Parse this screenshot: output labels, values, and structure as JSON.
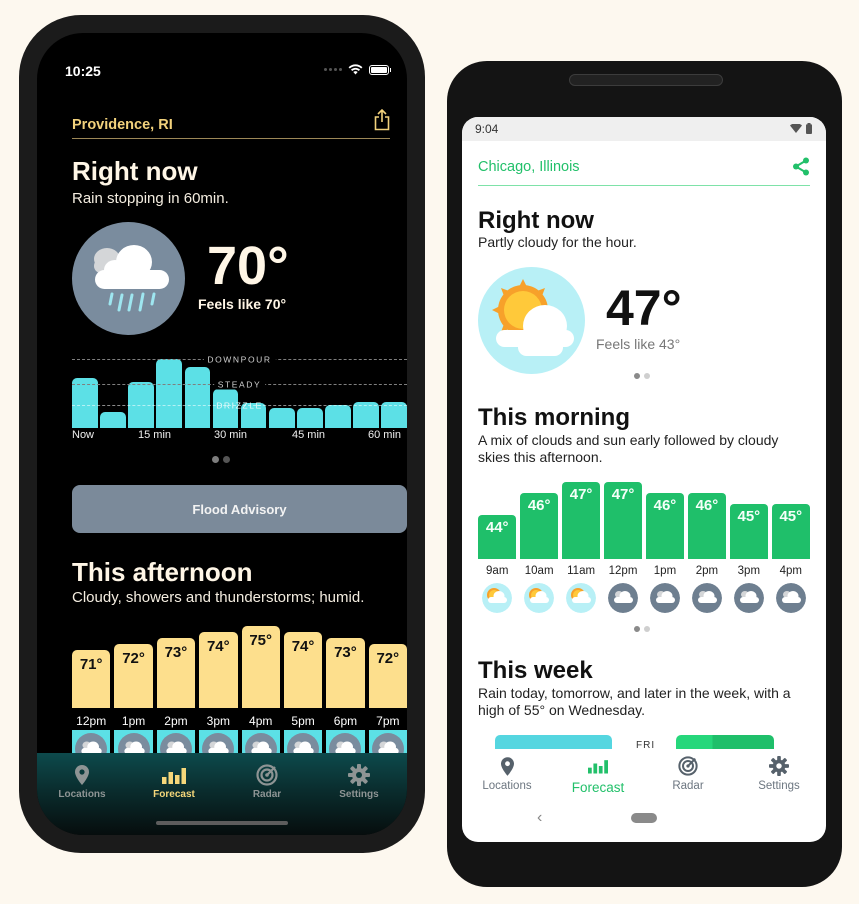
{
  "ios": {
    "status": {
      "time": "10:25",
      "icons": [
        "signal-dots-icon",
        "wifi-icon",
        "battery-icon"
      ]
    },
    "header": {
      "location": "Providence, RI",
      "share_icon": "share-icon"
    },
    "right_now": {
      "title": "Right now",
      "summary": "Rain stopping in 60min.",
      "condition_icon": "rain-cloud-icon",
      "temperature": "70°",
      "feels_like": "Feels like 70°"
    },
    "precipitation": {
      "levels": [
        "DOWNPOUR",
        "STEADY",
        "DRIZZLE"
      ],
      "intensity": [
        0.73,
        0.23,
        0.66,
        1.0,
        0.88,
        0.57,
        0.36,
        0.29,
        0.29,
        0.33,
        0.37,
        0.38
      ],
      "ticks": [
        "Now",
        "15 min",
        "30 min",
        "45 min",
        "60 min"
      ],
      "color": "#5ce0e6"
    },
    "pager": {
      "pages": 2,
      "active": 0
    },
    "advisory": {
      "label": "Flood Advisory"
    },
    "afternoon": {
      "title": "This afternoon",
      "summary": "Cloudy, showers and thunderstorms; humid.",
      "hours": [
        {
          "time": "12pm",
          "temp": "71°",
          "value": 71,
          "icon": "cloudy-icon"
        },
        {
          "time": "1pm",
          "temp": "72°",
          "value": 72,
          "icon": "cloudy-icon"
        },
        {
          "time": "2pm",
          "temp": "73°",
          "value": 73,
          "icon": "thunderstorm-icon"
        },
        {
          "time": "3pm",
          "temp": "74°",
          "value": 74,
          "icon": "cloudy-icon"
        },
        {
          "time": "4pm",
          "temp": "75°",
          "value": 75,
          "icon": "cloudy-icon"
        },
        {
          "time": "5pm",
          "temp": "74°",
          "value": 74,
          "icon": "cloudy-icon"
        },
        {
          "time": "6pm",
          "temp": "73°",
          "value": 73,
          "icon": "cloudy-icon"
        },
        {
          "time": "7pm",
          "temp": "72°",
          "value": 72,
          "icon": "thunderstorm-icon"
        }
      ],
      "bar_color": "#fddf8d"
    },
    "tabs": [
      {
        "label": "Locations",
        "icon": "location-pin-icon",
        "active": false
      },
      {
        "label": "Forecast",
        "icon": "bar-chart-icon",
        "active": true
      },
      {
        "label": "Radar",
        "icon": "radar-icon",
        "active": false
      },
      {
        "label": "Settings",
        "icon": "gear-icon",
        "active": false
      }
    ],
    "accent": "#f2d27c"
  },
  "android": {
    "status": {
      "time": "9:04",
      "icons": [
        "wifi-icon",
        "battery-icon"
      ]
    },
    "header": {
      "location": "Chicago, Illinois",
      "share_icon": "share-icon"
    },
    "right_now": {
      "title": "Right now",
      "summary": "Partly cloudy for the hour.",
      "condition_icon": "partly-cloudy-icon",
      "temperature": "47°",
      "feels_like": "Feels like 43°"
    },
    "pager_top": {
      "pages": 2,
      "active": 0
    },
    "morning": {
      "title": "This morning",
      "summary": "A mix of clouds and sun early followed by cloudy skies this afternoon.",
      "hours": [
        {
          "time": "9am",
          "temp": "44°",
          "value": 44,
          "icon": "partly-cloudy-icon"
        },
        {
          "time": "10am",
          "temp": "46°",
          "value": 46,
          "icon": "partly-cloudy-icon"
        },
        {
          "time": "11am",
          "temp": "47°",
          "value": 47,
          "icon": "partly-cloudy-icon"
        },
        {
          "time": "12pm",
          "temp": "47°",
          "value": 47,
          "icon": "cloudy-icon"
        },
        {
          "time": "1pm",
          "temp": "46°",
          "value": 46,
          "icon": "cloudy-icon"
        },
        {
          "time": "2pm",
          "temp": "46°",
          "value": 46,
          "icon": "cloudy-icon"
        },
        {
          "time": "3pm",
          "temp": "45°",
          "value": 45,
          "icon": "cloudy-icon"
        },
        {
          "time": "4pm",
          "temp": "45°",
          "value": 45,
          "icon": "cloudy-icon"
        }
      ],
      "bar_color": "#1fbf6a"
    },
    "pager_mid": {
      "pages": 2,
      "active": 0
    },
    "week": {
      "title": "This week",
      "summary": "Rain today, tomorrow, and later in the week, with a high of 55° on Wednesday.",
      "partial_label": "FRI"
    },
    "tabs": [
      {
        "label": "Locations",
        "icon": "location-pin-icon",
        "active": false
      },
      {
        "label": "Forecast",
        "icon": "bar-chart-icon",
        "active": true
      },
      {
        "label": "Radar",
        "icon": "radar-icon",
        "active": false
      },
      {
        "label": "Settings",
        "icon": "gear-icon",
        "active": false
      }
    ],
    "system_nav": {
      "back": "‹"
    },
    "accent": "#22c06a"
  }
}
